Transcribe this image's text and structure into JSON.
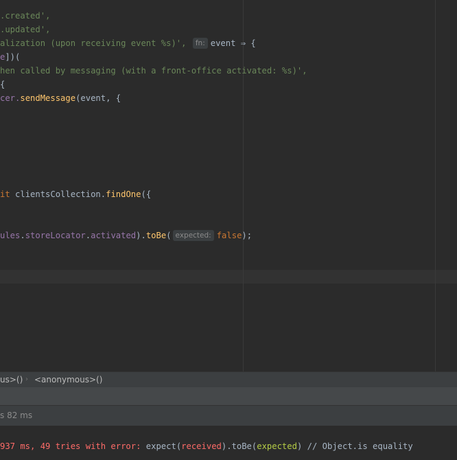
{
  "editor": {
    "lines": [
      {
        "s": ".created',"
      },
      {
        "s": ".updated',"
      },
      {
        "s": "alization (upon receiving event %s)',",
        "hint": "fn:",
        "rest1": "event",
        "arrow": " ⇒ {"
      },
      {
        "s": "e",
        "rest": "])("
      },
      {
        "s": "hen called by messaging (with a front-office activated: %s)',"
      },
      {
        "rest": "{"
      },
      {
        "pre": "cer.",
        "fn": "sendMessage",
        "rest": "(event, {"
      },
      {
        "kw": "it",
        "pre": " clientsCollection.",
        "fn": "findOne",
        "rest": "({"
      },
      {
        "prop1": "ules",
        "dot1": ".",
        "prop2": "storeLocator",
        "dot2": ".",
        "prop3": "activated",
        "pre": ").",
        "fn": "toBe",
        "rest": "(",
        "hint": "expected:",
        "kw2": "false",
        "end": ");"
      }
    ]
  },
  "breadcrumbs": {
    "item1": "us>()",
    "separator": "›",
    "item2": "<anonymous>()"
  },
  "status": {
    "text": "s 82 ms"
  },
  "console": {
    "error_prefix": "937 ms, 49 tries with error: ",
    "expect": "expect(",
    "received": "received",
    "mid": ").toBe(",
    "expected": "expected",
    "tail": ") // Object.is equality"
  }
}
